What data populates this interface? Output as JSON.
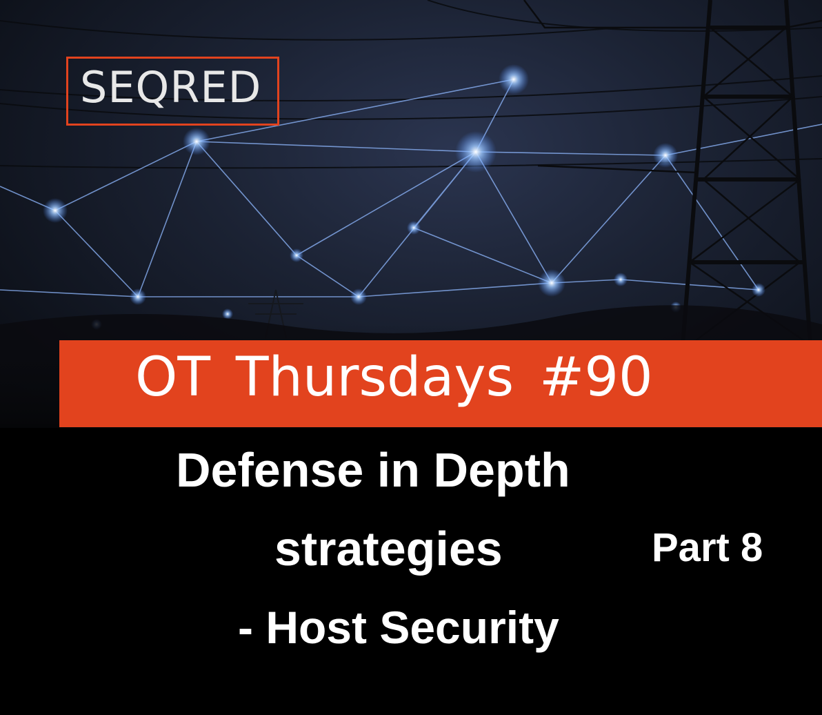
{
  "logo": {
    "text": "SEQRED",
    "border_color": "#e2431e"
  },
  "banner": {
    "text": "OT Thursdays #90",
    "color": "#e2431e"
  },
  "headline": {
    "line1": "Defense in Depth",
    "line2": "strategies",
    "part": "Part 8",
    "line3": "- Host Security"
  }
}
